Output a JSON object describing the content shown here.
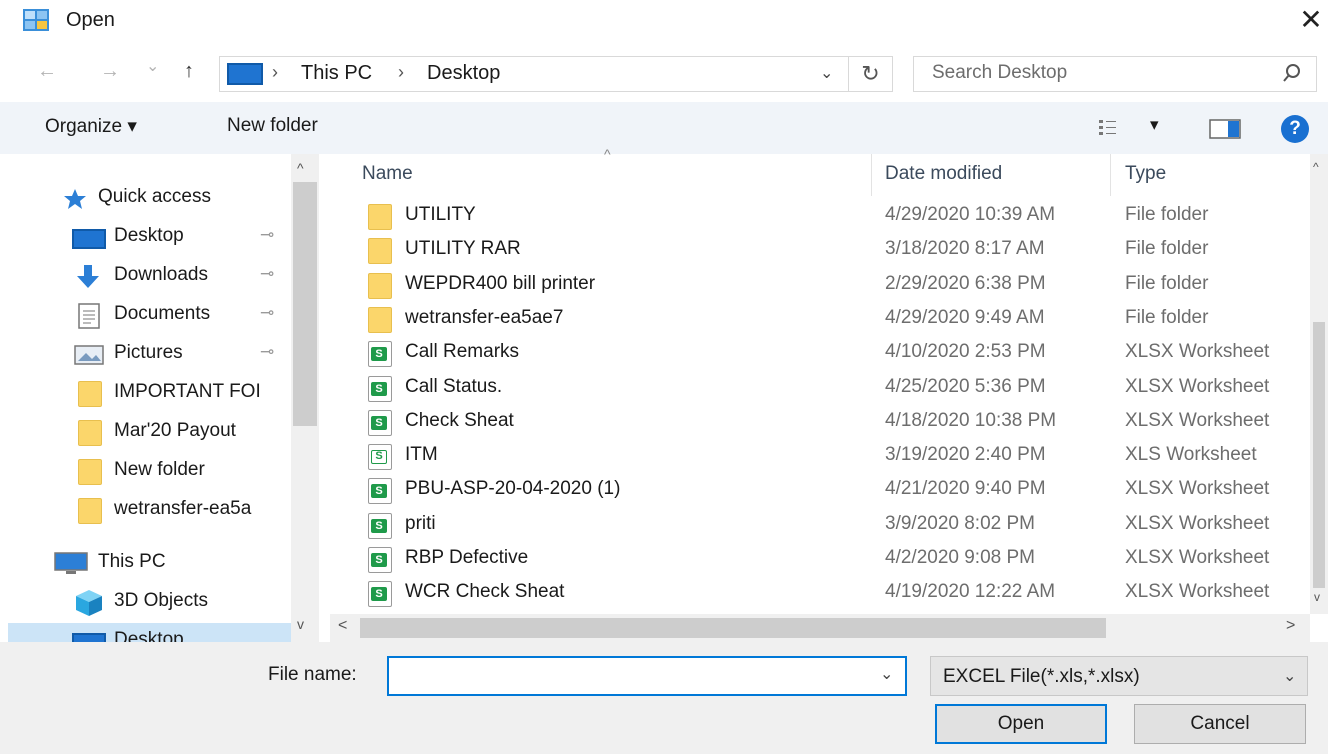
{
  "window": {
    "title": "Open",
    "close_glyph": "✕"
  },
  "navigation": {
    "back_glyph": "←",
    "forward_glyph": "→",
    "recent_glyph": "⌄",
    "up_glyph": "↑",
    "breadcrumb": [
      "This PC",
      "Desktop"
    ],
    "breadcrumb_sep": "›",
    "address_dropdown_glyph": "⌄",
    "refresh_glyph": "↻"
  },
  "search": {
    "placeholder": "Search Desktop"
  },
  "toolbar": {
    "organize_label": "Organize ▾",
    "new_folder_label": "New folder",
    "view_dropdown_glyph": "▾",
    "help_label": "?"
  },
  "sidebar": {
    "items": [
      {
        "label": "Quick access",
        "icon": "star-icon",
        "pinned": false
      },
      {
        "label": "Desktop",
        "icon": "desktop-icon",
        "pinned": true
      },
      {
        "label": "Downloads",
        "icon": "download-icon",
        "pinned": true
      },
      {
        "label": "Documents",
        "icon": "documents-icon",
        "pinned": true
      },
      {
        "label": "Pictures",
        "icon": "pictures-icon",
        "pinned": true
      },
      {
        "label": "IMPORTANT FOI",
        "icon": "folder-icon",
        "pinned": false
      },
      {
        "label": "Mar'20 Payout",
        "icon": "folder-icon",
        "pinned": false
      },
      {
        "label": "New folder",
        "icon": "folder-icon",
        "pinned": false
      },
      {
        "label": "wetransfer-ea5a",
        "icon": "folder-icon",
        "pinned": false
      },
      {
        "label": "This PC",
        "icon": "computer-icon",
        "pinned": false
      },
      {
        "label": "3D Objects",
        "icon": "cube-icon",
        "pinned": false
      },
      {
        "label": "Desktop",
        "icon": "desktop-icon",
        "pinned": false
      }
    ],
    "pin_glyph": "📌"
  },
  "file_list": {
    "columns": [
      "Name",
      "Date modified",
      "Type"
    ],
    "sort_glyph": "^",
    "rows": [
      {
        "name": "UTILITY",
        "date": "4/29/2020 10:39 AM",
        "type": "File folder",
        "kind": "folder"
      },
      {
        "name": "UTILITY RAR",
        "date": "3/18/2020 8:17 AM",
        "type": "File folder",
        "kind": "folder"
      },
      {
        "name": "WEPDR400 bill printer",
        "date": "2/29/2020 6:38 PM",
        "type": "File folder",
        "kind": "folder"
      },
      {
        "name": "wetransfer-ea5ae7",
        "date": "4/29/2020 9:49 AM",
        "type": "File folder",
        "kind": "folder"
      },
      {
        "name": "Call Remarks",
        "date": "4/10/2020 2:53 PM",
        "type": "XLSX Worksheet",
        "kind": "xlsx"
      },
      {
        "name": "Call Status.",
        "date": "4/25/2020 5:36 PM",
        "type": "XLSX Worksheet",
        "kind": "xlsx"
      },
      {
        "name": "Check Sheat",
        "date": "4/18/2020 10:38 PM",
        "type": "XLSX Worksheet",
        "kind": "xlsx"
      },
      {
        "name": "ITM",
        "date": "3/19/2020 2:40 PM",
        "type": "XLS Worksheet",
        "kind": "xls"
      },
      {
        "name": "PBU-ASP-20-04-2020 (1)",
        "date": "4/21/2020 9:40 PM",
        "type": "XLSX Worksheet",
        "kind": "xlsx"
      },
      {
        "name": "priti",
        "date": "3/9/2020 8:02 PM",
        "type": "XLSX Worksheet",
        "kind": "xlsx"
      },
      {
        "name": "RBP Defective",
        "date": "4/2/2020 9:08 PM",
        "type": "XLSX Worksheet",
        "kind": "xlsx"
      },
      {
        "name": "WCR Check Sheat",
        "date": "4/19/2020 12:22 AM",
        "type": "XLSX Worksheet",
        "kind": "xlsx"
      }
    ],
    "excel_badge": "S"
  },
  "footer": {
    "file_name_label": "File name:",
    "file_name_value": "",
    "file_type_value": "EXCEL File(*.xls,*.xlsx)",
    "dropdown_glyph": "⌄",
    "open_label": "Open",
    "cancel_label": "Cancel"
  },
  "scrollbars": {
    "up_glyph": "^",
    "down_glyph": "v",
    "left_glyph": "<",
    "right_glyph": ">"
  },
  "colors": {
    "accent": "#0078d7",
    "toolbar_bg": "#f0f4f9",
    "folder": "#fbd66b",
    "excel_green": "#1f9a4a"
  }
}
